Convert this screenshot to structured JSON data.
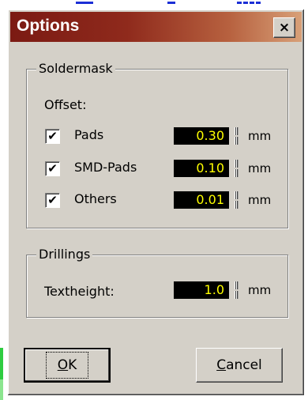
{
  "window": {
    "title": "Options",
    "close_label": "×"
  },
  "soldermask": {
    "title": "Soldermask",
    "offset_label": "Offset:",
    "rows": [
      {
        "label": "Pads",
        "checked": true,
        "value": "0.30",
        "unit": "mm"
      },
      {
        "label": "SMD-Pads",
        "checked": true,
        "value": "0.10",
        "unit": "mm"
      },
      {
        "label": "Others",
        "checked": true,
        "value": "0.01",
        "unit": "mm"
      }
    ]
  },
  "drillings": {
    "title": "Drillings",
    "textheight_label": "Textheight:",
    "value": "1.0",
    "unit": "mm"
  },
  "buttons": {
    "ok_mnemonic": "O",
    "ok_rest": "K",
    "cancel_mnemonic": "C",
    "cancel_rest": "ancel"
  },
  "colors": {
    "title_bar_start": "#7b1a13",
    "value_bg": "#000000",
    "value_text": "#ffff00"
  }
}
